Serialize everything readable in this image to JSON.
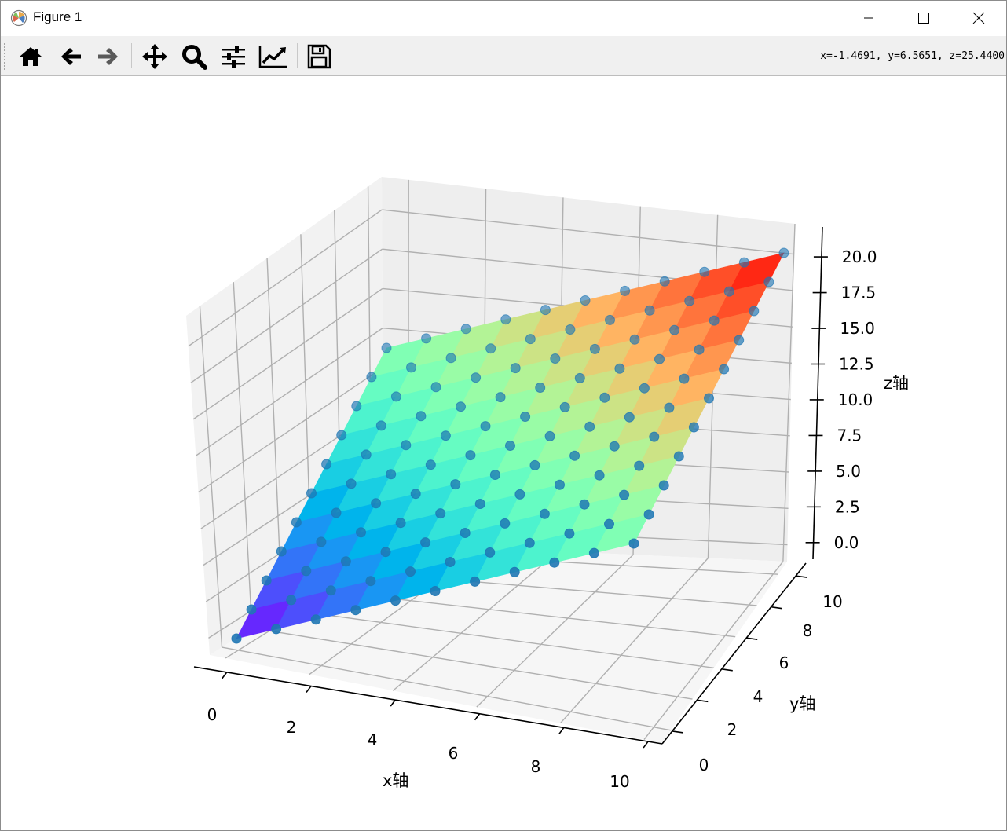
{
  "window": {
    "title": "Figure 1",
    "controls": {
      "minimize": "minimize",
      "maximize": "maximize",
      "close": "close"
    }
  },
  "toolbar": {
    "buttons": [
      {
        "name": "home",
        "icon": "home-icon"
      },
      {
        "name": "back",
        "icon": "arrow-left-icon"
      },
      {
        "name": "forward",
        "icon": "arrow-right-icon"
      },
      {
        "name": "pan",
        "icon": "move-icon"
      },
      {
        "name": "zoom",
        "icon": "zoom-icon"
      },
      {
        "name": "configure-subplots",
        "icon": "sliders-icon"
      },
      {
        "name": "edit-axes",
        "icon": "chart-line-icon"
      },
      {
        "name": "save",
        "icon": "floppy-disk-icon"
      }
    ],
    "coordinates": "x=-1.4691, y=6.5651, z=25.4400"
  },
  "chart_data": {
    "type": "surface",
    "title": "",
    "xlabel": "x轴",
    "ylabel": "y轴",
    "zlabel": "z轴",
    "x_ticks": [
      "0",
      "2",
      "4",
      "6",
      "8",
      "10"
    ],
    "y_ticks": [
      "0",
      "2",
      "4",
      "6",
      "8",
      "10"
    ],
    "z_ticks": [
      "0.0",
      "2.5",
      "5.0",
      "7.5",
      "10.0",
      "12.5",
      "15.0",
      "17.5",
      "20.0"
    ],
    "xlim": [
      0,
      10
    ],
    "ylim": [
      0,
      10
    ],
    "zlim": [
      0,
      20
    ],
    "surface": "z = x + y",
    "x_values": [
      0,
      1,
      2,
      3,
      4,
      5,
      6,
      7,
      8,
      9,
      10
    ],
    "y_values": [
      0,
      1,
      2,
      3,
      4,
      5,
      6,
      7,
      8,
      9,
      10
    ],
    "colormap": "rainbow",
    "scatter": {
      "description_points": "z = x + y on integer grid",
      "color": "#1f77b4"
    },
    "grid": true
  }
}
